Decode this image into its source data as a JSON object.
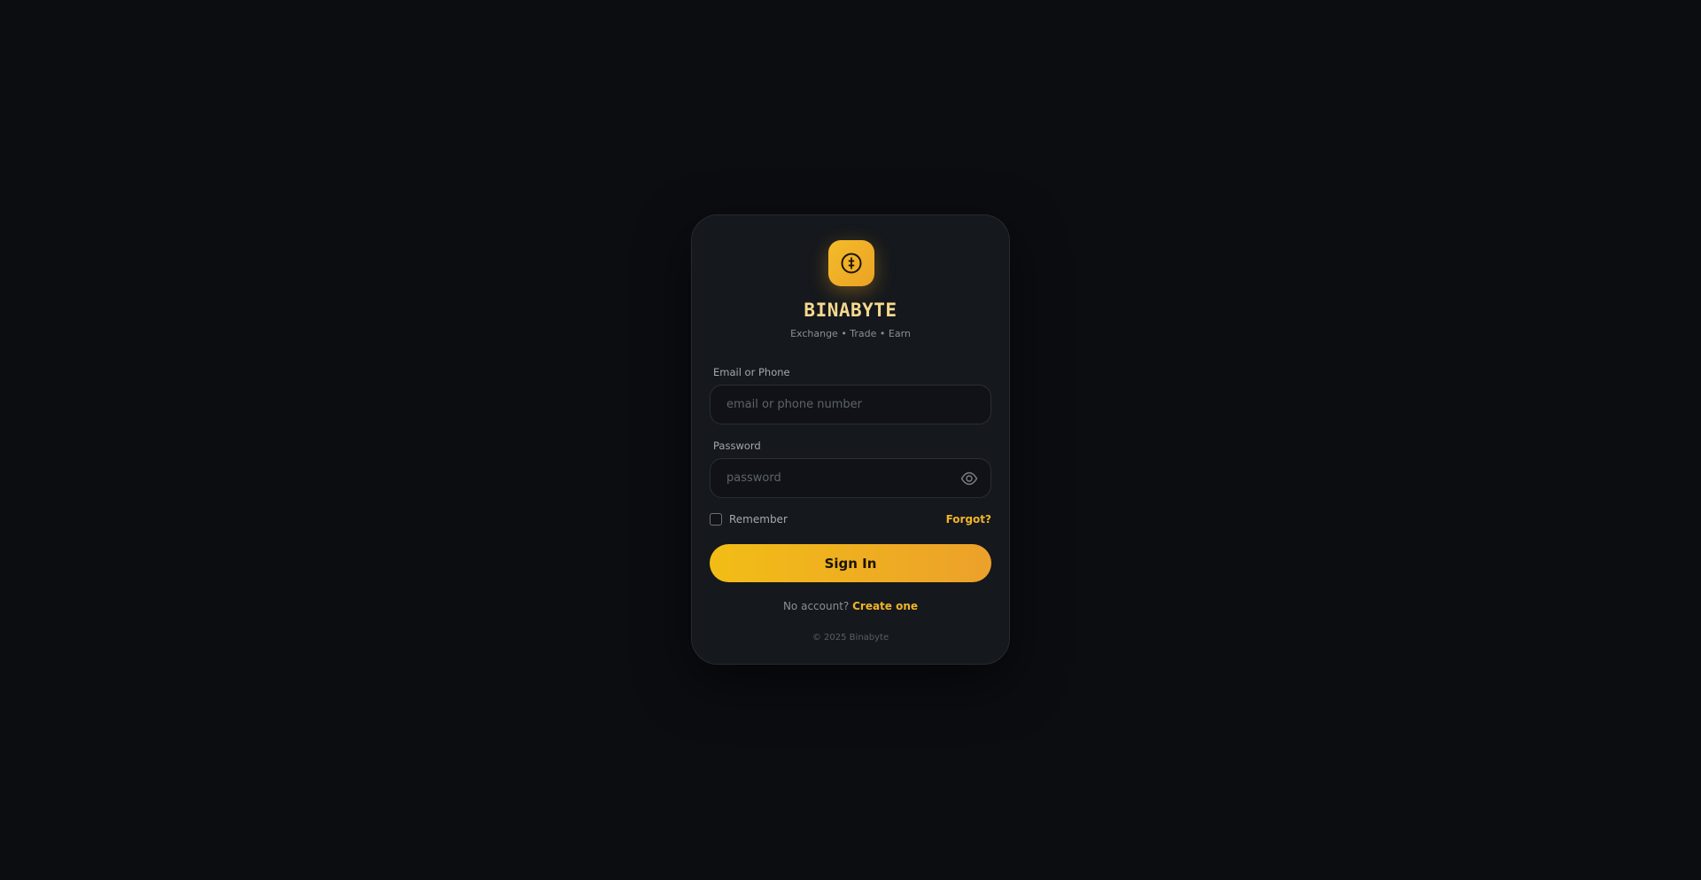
{
  "brand": {
    "name": "BINABYTE",
    "tagline": "Exchange • Trade • Earn",
    "logo_icon": "crypto-coin-icon",
    "accent_color": "#f0b429"
  },
  "form": {
    "email": {
      "label": "Email or Phone",
      "placeholder": "email or phone number",
      "value": ""
    },
    "password": {
      "label": "Password",
      "placeholder": "password",
      "value": "",
      "toggle_icon": "eye-icon"
    },
    "remember_label": "Remember",
    "remember_checked": false,
    "forgot_label": "Forgot?",
    "submit_label": "Sign In"
  },
  "signup": {
    "prompt": "No account?",
    "link_label": "Create one"
  },
  "footer": {
    "copyright": "© 2025 Binabyte"
  }
}
